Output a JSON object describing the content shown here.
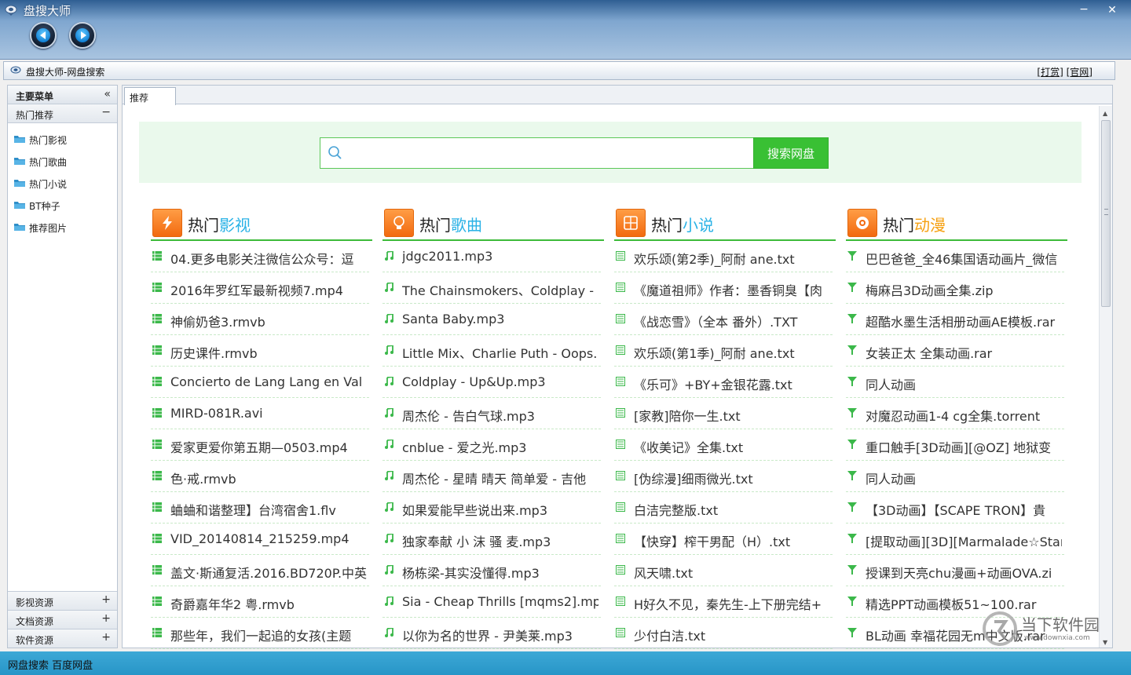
{
  "window": {
    "title": "盘搜大师",
    "minimize": "−",
    "close": "✕"
  },
  "address": {
    "text": "盘搜大师-网盘搜索",
    "link_tip": "[打赏]",
    "link_site": "[官网]"
  },
  "sidebar": {
    "header": "主要菜单",
    "collapse_icon": "«",
    "group_hot": "热门推荐",
    "group_hot_toggle": "−",
    "items": [
      {
        "label": "热门影视"
      },
      {
        "label": "热门歌曲"
      },
      {
        "label": "热门小说"
      },
      {
        "label": "BT种子"
      },
      {
        "label": "推荐图片"
      }
    ],
    "bottom_groups": [
      {
        "label": "影视资源",
        "toggle": "+"
      },
      {
        "label": "文档资源",
        "toggle": "+"
      },
      {
        "label": "软件资源",
        "toggle": "+"
      }
    ]
  },
  "tabs": [
    {
      "label": "推荐"
    }
  ],
  "search": {
    "placeholder": "",
    "button": "搜索网盘"
  },
  "colors": {
    "accent_green": "#39c034",
    "film_accent": "#2ab2e6",
    "music_accent": "#2ab2e6",
    "novel_accent": "#2ab2e6",
    "anime_accent": "#f5a011"
  },
  "columns": [
    {
      "prefix": "热门",
      "accent": "影视",
      "icon": "lightning-icon",
      "row_icon": "film-icon",
      "items": [
        "04.更多电影关注微信公众号：逗",
        "2016年罗红军最新视频7.mp4",
        "神偷奶爸3.rmvb",
        "历史课件.rmvb",
        "Concierto de Lang Lang en Val",
        "MIRD-081R.avi",
        "爱家更爱你第五期—0503.mp4",
        "色·戒.rmvb",
        "蛐蛐和谐整理】台湾宿舍1.flv",
        "VID_20140814_215259.mp4",
        "盖文·斯通复活.2016.BD720P.中英",
        "奇爵嘉年华2 粤.rmvb",
        "那些年，我们一起追的女孩(主题"
      ]
    },
    {
      "prefix": "热门",
      "accent": "歌曲",
      "icon": "bulb-icon",
      "row_icon": "music-note-icon",
      "items": [
        "jdgc2011.mp3",
        "The Chainsmokers、Coldplay -",
        "Santa Baby.mp3",
        "Little Mix、Charlie Puth - Oops.",
        "Coldplay - Up&Up.mp3",
        "周杰伦 - 告白气球.mp3",
        "cnblue - 爱之光.mp3",
        "周杰伦 - 星晴 晴天 简单爱 - 吉他",
        "如果爱能早些说出来.mp3",
        "独家奉献 小 沫 骚 麦.mp3",
        "杨栋梁-其实没懂得.mp3",
        "Sia - Cheap Thrills [mqms2].mp",
        "以你为名的世界 - 尹美莱.mp3"
      ]
    },
    {
      "prefix": "热门",
      "accent": "小说",
      "icon": "book-icon",
      "row_icon": "doc-icon",
      "items": [
        "欢乐颂(第2季)_阿耐 ane.txt",
        "《魔道祖师》作者：墨香铜臭【肉",
        "《战恋雪》（全本 番外）.TXT",
        "欢乐颂(第1季)_阿耐 ane.txt",
        "《乐可》+BY+金银花露.txt",
        "[家教]陪你一生.txt",
        "《收美记》全集.txt",
        "[伪综漫]细雨微光.txt",
        "白洁完整版.txt",
        "【快穿】榨干男配（H）.txt",
        "风天啸.txt",
        "H好久不见，秦先生-上下册完结+",
        "少付白洁.txt"
      ]
    },
    {
      "prefix": "热门",
      "accent": "动漫",
      "icon": "anime-icon",
      "row_icon": "filter-icon",
      "items": [
        "巴巴爸爸_全46集国语动画片_微信",
        "梅麻吕3D动画全集.zip",
        "超酷水墨生活相册动画AE模板.rar",
        "女装正太 全集动画.rar",
        "同人动画",
        "对魔忍动画1-4 cg全集.torrent",
        "重口触手[3D动画][@OZ] 地狱变",
        "同人动画",
        "【3D动画】【SCAPE TRON】貴",
        "[提取动画][3D][Marmalade☆Star",
        "授课到天亮chu漫画+动画OVA.zi",
        "精选PPT动画模板51~100.rar",
        "BL动画 幸福花园无m中文版.rar"
      ]
    }
  ],
  "statusbar": {
    "text": "网盘搜索 百度网盘"
  },
  "watermark": {
    "text": "当下软件园",
    "sub": "www.downxia.com"
  }
}
